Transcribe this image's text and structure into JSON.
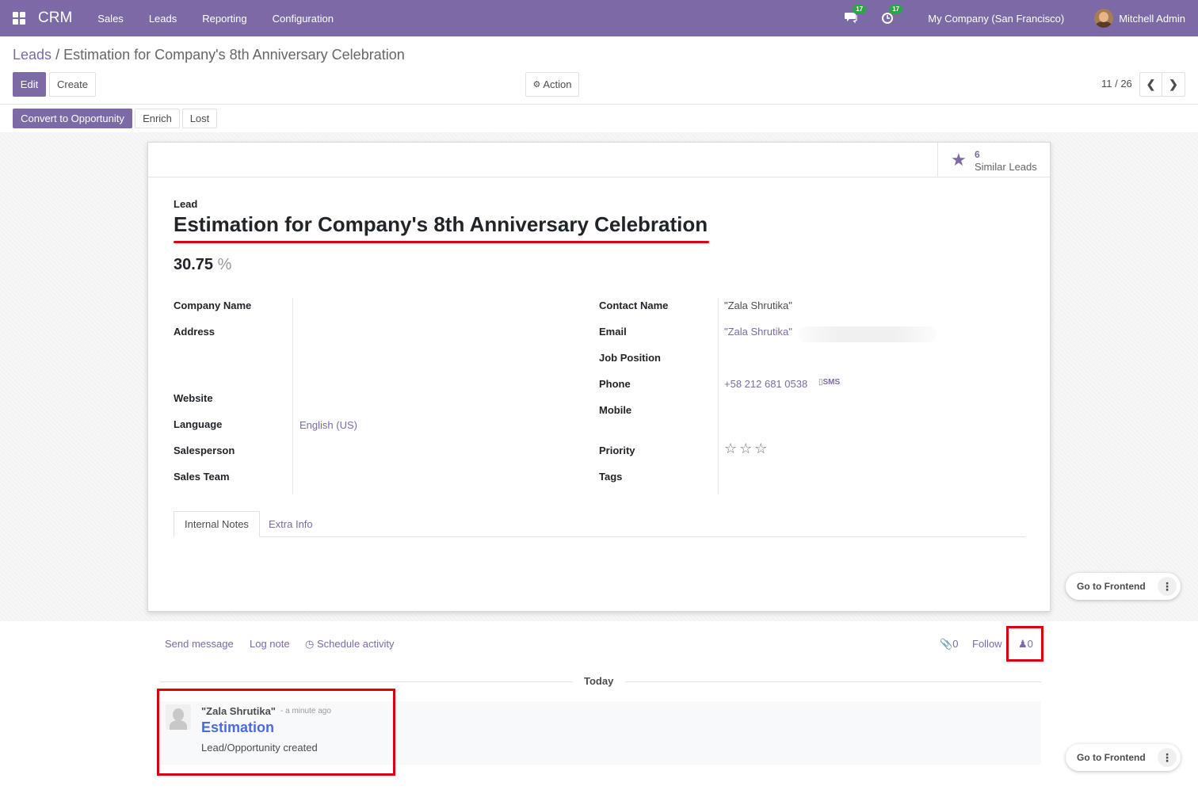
{
  "navbar": {
    "brand": "CRM",
    "menu": [
      "Sales",
      "Leads",
      "Reporting",
      "Configuration"
    ],
    "messages_badge": "17",
    "activities_badge": "17",
    "company": "My Company (San Francisco)",
    "user": "Mitchell Admin",
    "color": "#7c6aa6"
  },
  "breadcrumb": {
    "parent": "Leads",
    "separator": "/",
    "current": "Estimation for Company's 8th Anniversary Celebration"
  },
  "control": {
    "edit": "Edit",
    "create": "Create",
    "action": "Action",
    "pager": "11 / 26"
  },
  "statusbar": {
    "convert": "Convert to Opportunity",
    "enrich": "Enrich",
    "lost": "Lost"
  },
  "smart_button": {
    "count": "6",
    "label": "Similar Leads"
  },
  "form": {
    "type_label": "Lead",
    "title": "Estimation for Company's 8th Anniversary Celebration",
    "probability": "30.75",
    "probability_unit": "%",
    "left_fields": {
      "company_name": "Company Name",
      "address": "Address",
      "website": "Website",
      "language": "Language",
      "language_value": "English (US)",
      "salesperson": "Salesperson",
      "sales_team": "Sales Team"
    },
    "right_fields": {
      "contact_name": "Contact Name",
      "contact_name_value": "\"Zala Shrutika\"",
      "email": "Email",
      "email_value": "\"Zala Shrutika\"",
      "job_position": "Job Position",
      "phone": "Phone",
      "phone_value": "+58 212 681 0538",
      "sms": "SMS",
      "mobile": "Mobile",
      "priority": "Priority",
      "priority_stars": 0,
      "tags": "Tags"
    },
    "tabs": [
      "Internal Notes",
      "Extra Info"
    ]
  },
  "go_frontend": "Go to Frontend",
  "chatter": {
    "send_message": "Send message",
    "log_note": "Log note",
    "schedule_activity": "Schedule activity",
    "attachments": "0",
    "follow": "Follow",
    "followers": "0",
    "date_separator": "Today",
    "message": {
      "author": "\"Zala Shrutika\"",
      "time": "- a minute ago",
      "title": "Estimation",
      "body": "Lead/Opportunity created"
    }
  },
  "highlight_color": "#e0000c"
}
